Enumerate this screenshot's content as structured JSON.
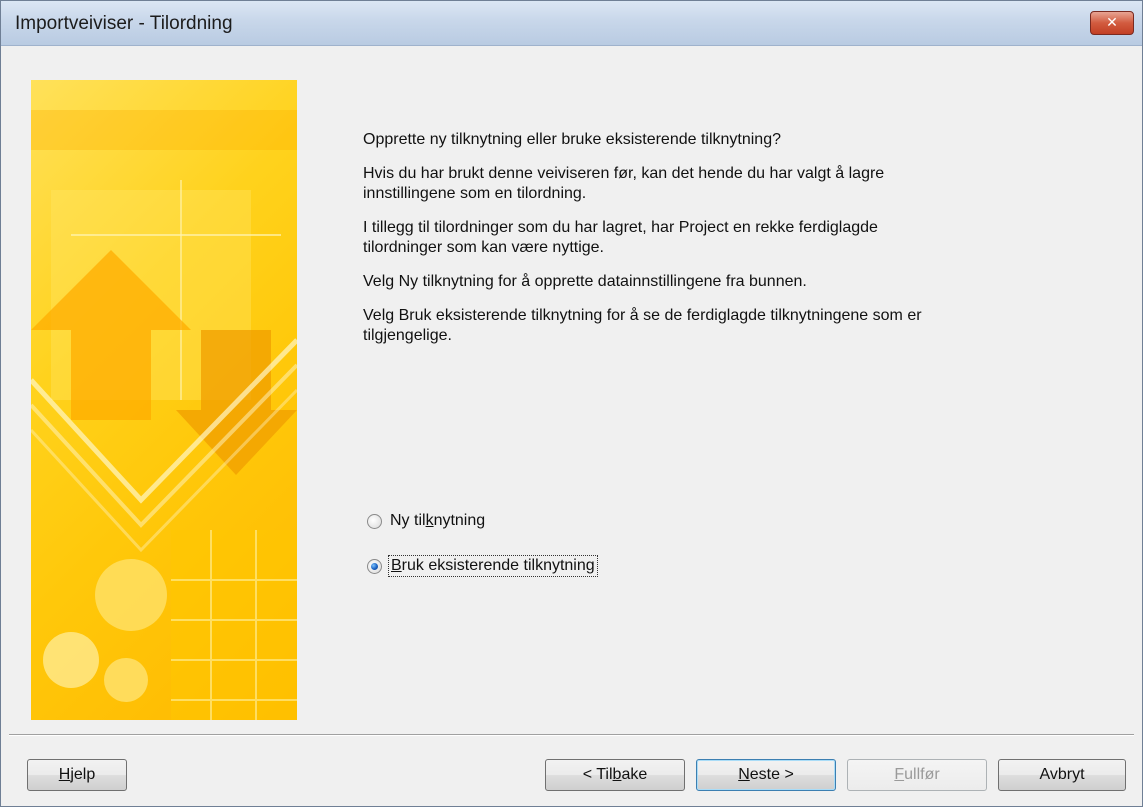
{
  "window": {
    "title": "Importveiviser - Tilordning",
    "close_icon": "close-icon"
  },
  "main": {
    "heading": "Opprette ny tilknytning eller bruke eksisterende tilknytning?",
    "paragraphs": [
      "Hvis du har brukt denne veiviseren før, kan det hende du har valgt å lagre innstillingene som en tilordning.",
      "I tillegg til tilordninger som du har lagret, har Project en rekke ferdiglagde tilordninger som kan være nyttige.",
      "Velg Ny tilknytning for å opprette datainnstillingene fra bunnen.",
      "Velg Bruk eksisterende tilknytning for å se de ferdiglagde tilknytningene som er tilgjengelige."
    ],
    "options": [
      {
        "label_pre": "Ny til",
        "label_u": "k",
        "label_post": "nytning",
        "checked": false
      },
      {
        "label_pre": "",
        "label_u": "B",
        "label_post": "ruk eksisterende tilknytning",
        "checked": true
      }
    ]
  },
  "buttons": {
    "help": {
      "pre": "",
      "u": "H",
      "post": "jelp"
    },
    "back": {
      "pre": "< Til",
      "u": "b",
      "post": "ake"
    },
    "next": {
      "pre": "",
      "u": "N",
      "post": "este >"
    },
    "finish": {
      "pre": "",
      "u": "F",
      "post": "ullfør"
    },
    "cancel": {
      "pre": "Avbryt",
      "u": "",
      "post": ""
    }
  },
  "colors": {
    "art_base": "#ffd21c",
    "title_bar": "#c8d7ea",
    "default_button_border": "#3c7fb1"
  }
}
